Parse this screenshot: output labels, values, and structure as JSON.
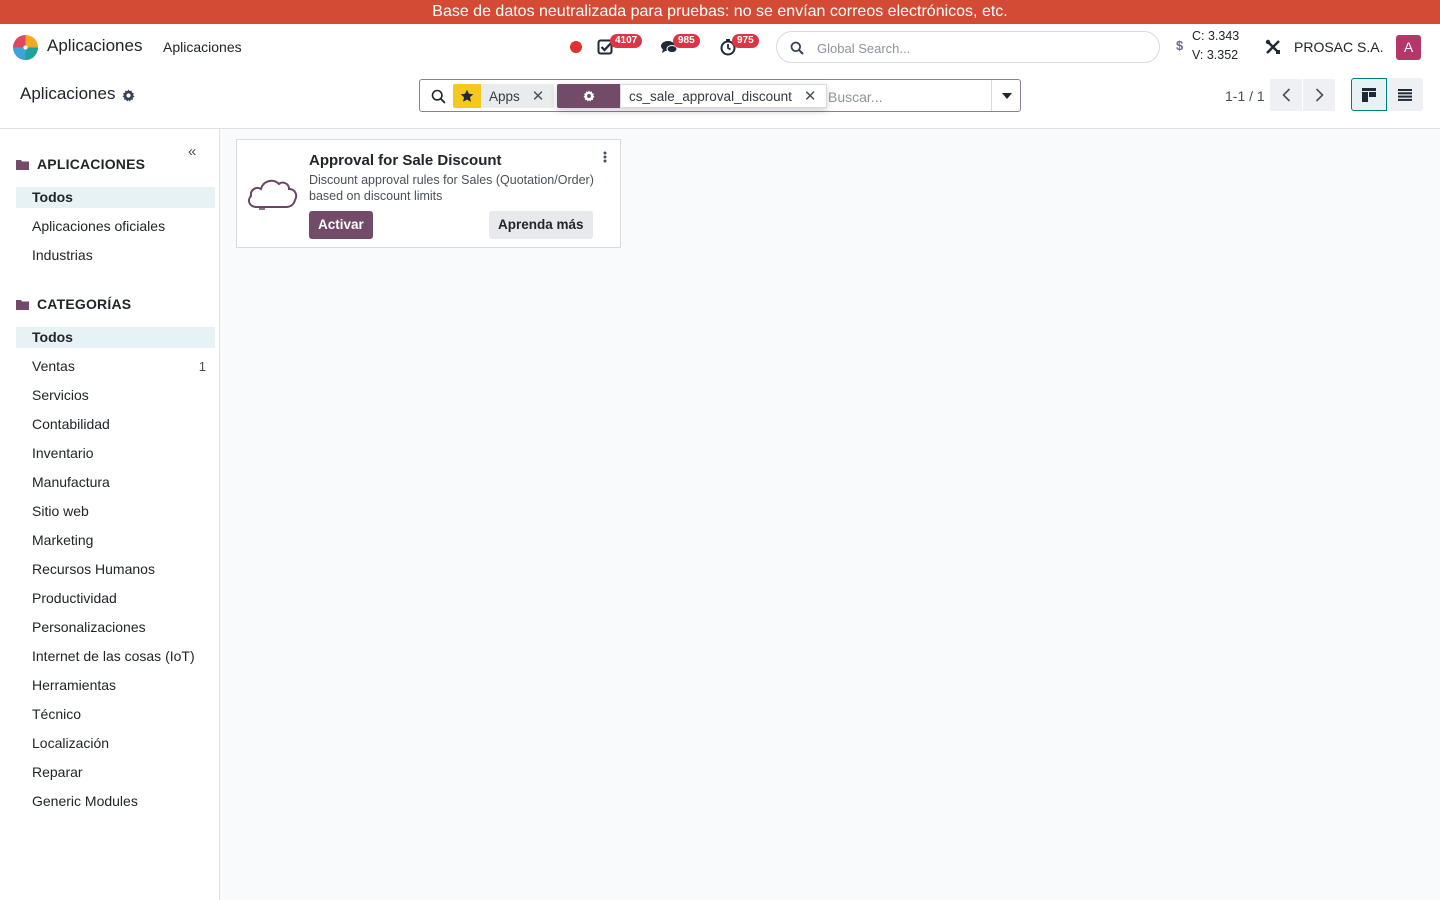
{
  "banner": {
    "text": "Base de datos neutralizada para pruebas: no se envían correos electrónicos, etc."
  },
  "navbar": {
    "app_title": "Aplicaciones",
    "menu_item": "Aplicaciones",
    "activities_count": "4107",
    "messages_count": "985",
    "timer_count": "975",
    "global_search_placeholder": "Global Search...",
    "currency_symbol": "$",
    "rate_c": "C: 3.343",
    "rate_v": "V: 3.352",
    "company": "PROSAC S.A.",
    "avatar_initial": "A",
    "colors": {
      "banner": "#d34a35",
      "brand": "#714b67",
      "badge": "#dc3545",
      "avatar": "#b5376a"
    }
  },
  "control_panel": {
    "breadcrumb": "Aplicaciones",
    "facets": [
      {
        "icon": "star-icon",
        "value": "Apps"
      },
      {
        "icon": "gear-icon",
        "value": "cs_sale_approval_discount"
      }
    ],
    "search_placeholder": "Buscar...",
    "pager": "1-1 / 1",
    "views": [
      "kanban-view-icon",
      "list-view-icon"
    ]
  },
  "sidebar": {
    "apps_header": "APLICACIONES",
    "apps_items": [
      {
        "label": "Todos",
        "active": true
      },
      {
        "label": "Aplicaciones oficiales"
      },
      {
        "label": "Industrias"
      }
    ],
    "categories_header": "CATEGORÍAS",
    "category_items": [
      {
        "label": "Todos",
        "active": true
      },
      {
        "label": "Ventas",
        "count": "1"
      },
      {
        "label": "Servicios"
      },
      {
        "label": "Contabilidad"
      },
      {
        "label": "Inventario"
      },
      {
        "label": "Manufactura"
      },
      {
        "label": "Sitio web"
      },
      {
        "label": "Marketing"
      },
      {
        "label": "Recursos Humanos"
      },
      {
        "label": "Productividad"
      },
      {
        "label": "Personalizaciones"
      },
      {
        "label": "Internet de las cosas (IoT)"
      },
      {
        "label": "Herramientas"
      },
      {
        "label": "Técnico"
      },
      {
        "label": "Localización"
      },
      {
        "label": "Reparar"
      },
      {
        "label": "Generic Modules"
      }
    ]
  },
  "cards": [
    {
      "title": "Approval for Sale Discount",
      "summary": "Discount approval rules for Sales (Quotation/Order) based on discount limits",
      "activate_label": "Activar",
      "learn_label": "Aprenda más",
      "icon": "cloud-icon"
    }
  ]
}
